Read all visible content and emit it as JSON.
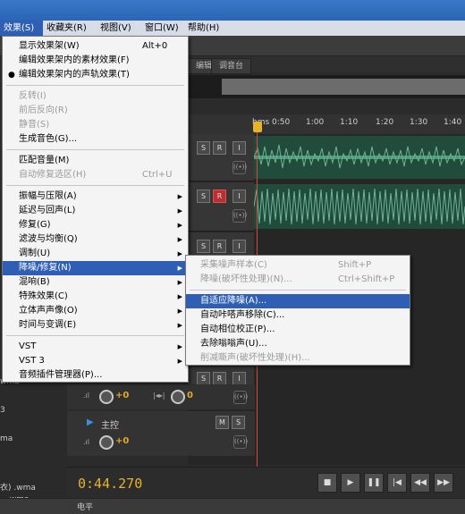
{
  "menubar": {
    "items": [
      {
        "label": "效果(S)",
        "active": true
      },
      {
        "label": "收藏夹(R)"
      },
      {
        "label": "视图(V)"
      },
      {
        "label": "窗口(W)"
      },
      {
        "label": "帮助(H)"
      }
    ]
  },
  "tabs": {
    "editor": "编辑器",
    "mixer": "调音台"
  },
  "ruler": {
    "ticks": [
      "hms 0:50",
      "1:00",
      "1:10",
      "1:20",
      "1:30",
      "1:40"
    ]
  },
  "track_buttons": {
    "m": "M",
    "s": "S",
    "r": "R",
    "i": "I",
    "io": "((•))"
  },
  "master": {
    "label": "主控",
    "m": "M",
    "s": "S",
    "volume": "+0",
    "pan": "0"
  },
  "tracks_knob": {
    "volume": "+0",
    "pan": "0"
  },
  "left_panel": {
    "items": [
      "wma",
      "3",
      "",
      "ma",
      "",
      "",
      "",
      "",
      "衣) .wma",
      ".wma"
    ]
  },
  "transport": {
    "time": "0:44.270"
  },
  "bottom": {
    "tab": "电平"
  },
  "effects_menu": {
    "items": [
      {
        "label": "显示效果架(W)",
        "shortcut": "Alt+0"
      },
      {
        "label": "编辑效果架内的素材效果(F)"
      },
      {
        "label": "编辑效果架内的声轨效果(T)",
        "checked": true
      },
      {
        "sep": true
      },
      {
        "label": "反转(I)",
        "disabled": true
      },
      {
        "label": "前后反向(R)",
        "disabled": true
      },
      {
        "label": "静音(S)",
        "disabled": true
      },
      {
        "label": "生成音色(G)..."
      },
      {
        "sep": true
      },
      {
        "label": "匹配音量(M)"
      },
      {
        "label": "自动修复选区(H)",
        "shortcut": "Ctrl+U",
        "disabled": true
      },
      {
        "sep": true
      },
      {
        "label": "振幅与压限(A)",
        "submenu": true
      },
      {
        "label": "延迟与回声(L)",
        "submenu": true
      },
      {
        "label": "修复(G)",
        "submenu": true
      },
      {
        "label": "滤波与均衡(Q)",
        "submenu": true
      },
      {
        "label": "调制(U)",
        "submenu": true
      },
      {
        "label": "降噪/修复(N)",
        "submenu": true,
        "highlighted": true
      },
      {
        "label": "混响(B)",
        "submenu": true
      },
      {
        "label": "特殊效果(C)",
        "submenu": true
      },
      {
        "label": "立体声声像(O)",
        "submenu": true
      },
      {
        "label": "时间与变调(E)",
        "submenu": true
      },
      {
        "sep": true
      },
      {
        "label": "VST",
        "submenu": true
      },
      {
        "label": "VST 3",
        "submenu": true
      },
      {
        "label": "音频插件管理器(P)..."
      }
    ]
  },
  "noise_submenu": {
    "items": [
      {
        "label": "采集噪声样本(C)",
        "shortcut": "Shift+P",
        "disabled": true
      },
      {
        "label": "降噪(破坏性处理)(N)...",
        "shortcut": "Ctrl+Shift+P",
        "disabled": true
      },
      {
        "sep": true
      },
      {
        "label": "自适应降噪(A)...",
        "highlighted": true
      },
      {
        "label": "自动咔嗒声移除(C)..."
      },
      {
        "label": "自动相位校正(P)..."
      },
      {
        "label": "去除嗡嗡声(U)..."
      },
      {
        "label": "削减嘶声(破坏性处理)(H)...",
        "disabled": true
      }
    ]
  },
  "colors": {
    "highlight": "#2e5fb5",
    "playhead": "#d24b3c",
    "timecode": "#e6b429",
    "waveform": "#2f6b54"
  }
}
